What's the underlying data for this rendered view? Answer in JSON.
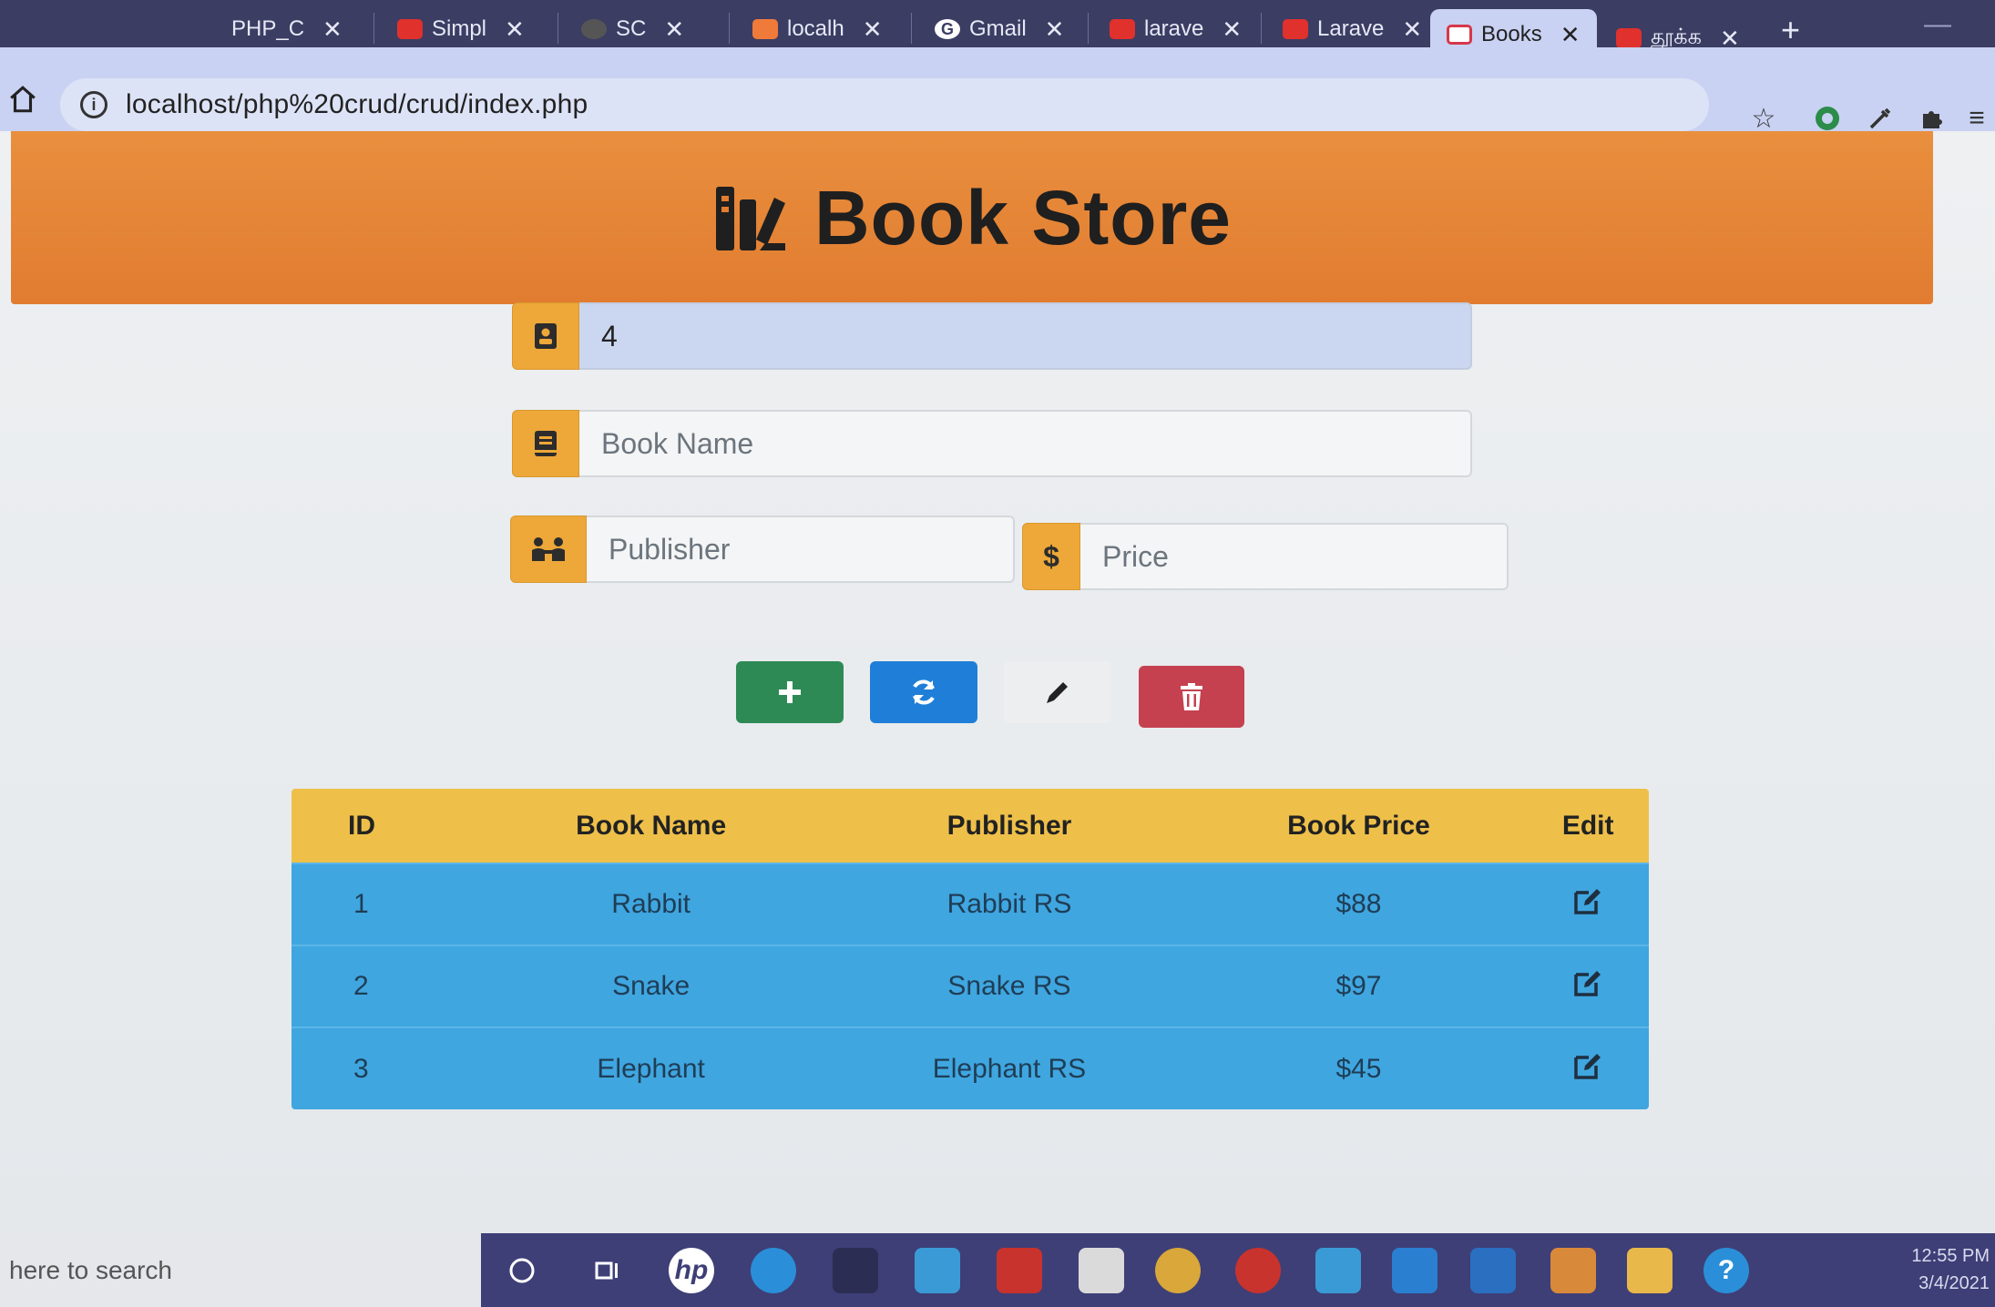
{
  "browser": {
    "tabs": [
      {
        "label": "PHP_C",
        "icon": "php-tab-icon"
      },
      {
        "label": "Simpl",
        "icon": "youtube-icon"
      },
      {
        "label": "SC",
        "icon": "site-icon"
      },
      {
        "label": "localh",
        "icon": "xampp-icon"
      },
      {
        "label": "Gmail",
        "icon": "google-icon"
      },
      {
        "label": "larave",
        "icon": "youtube-icon"
      },
      {
        "label": "Larave",
        "icon": "youtube-icon"
      },
      {
        "label": "Books",
        "icon": "books-tab-icon",
        "active": true
      },
      {
        "label": "தூக்க",
        "icon": "youtube-icon"
      }
    ],
    "url": "localhost/php%20crud/crud/index.php"
  },
  "page": {
    "title": "Book Store",
    "form": {
      "id_value": "4",
      "book_name_placeholder": "Book Name",
      "publisher_placeholder": "Publisher",
      "price_placeholder": "Price",
      "price_addon": "$"
    },
    "buttons": [
      "add",
      "refresh",
      "edit",
      "delete"
    ],
    "table": {
      "headers": [
        "ID",
        "Book Name",
        "Publisher",
        "Book Price",
        "Edit"
      ],
      "rows": [
        {
          "id": "1",
          "name": "Rabbit",
          "publisher": "Rabbit RS",
          "price": "$88"
        },
        {
          "id": "2",
          "name": "Snake",
          "publisher": "Snake RS",
          "price": "$97"
        },
        {
          "id": "3",
          "name": "Elephant",
          "publisher": "Elephant RS",
          "price": "$45"
        }
      ]
    }
  },
  "taskbar": {
    "search_text": "here to search",
    "time": "12:55 PM",
    "date": "3/4/2021"
  },
  "colors": {
    "banner": "#e17c30",
    "addon": "#eda839",
    "header_row": "#eec04a",
    "body_row": "#3fa6e0",
    "add_button": "#2e8a55",
    "refresh_button": "#1f7fd8",
    "delete_button": "#c5414f"
  }
}
